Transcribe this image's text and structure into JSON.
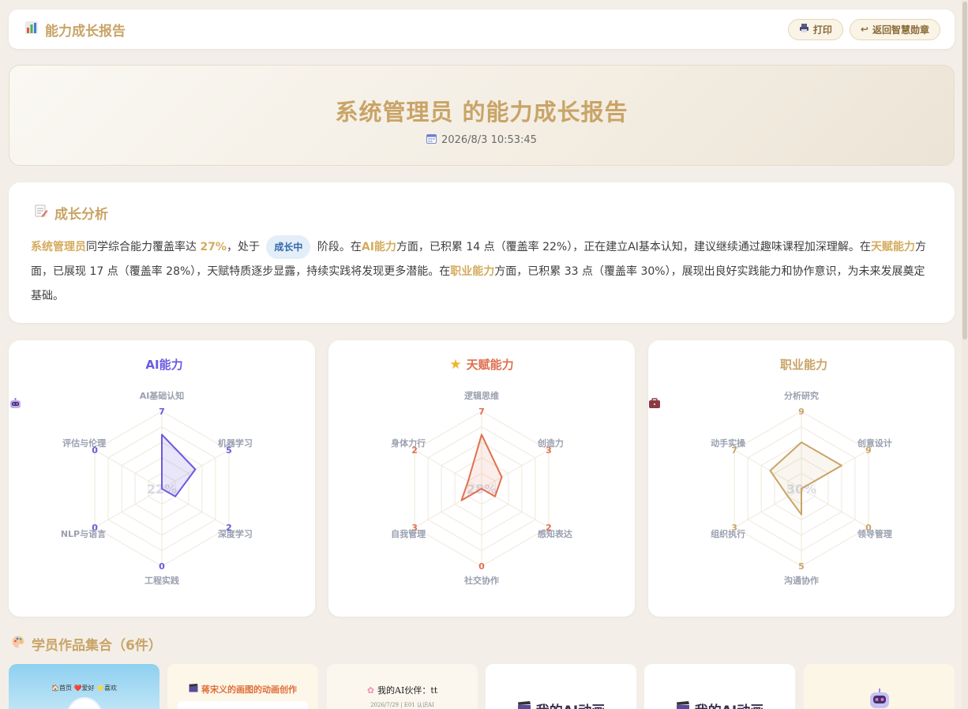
{
  "topbar": {
    "title": "能力成长报告",
    "print_label": "打印",
    "back_label": "返回智慧勋章"
  },
  "hero": {
    "title": "系统管理员 的能力成长报告",
    "date": "2026/8/3 10:53:45"
  },
  "analysis": {
    "heading": "成长分析",
    "name": "系统管理员",
    "t1": "同学综合能力覆盖率达 ",
    "rate": "27%",
    "t2": "，处于 ",
    "stage": "成长中",
    "t3": " 阶段。在",
    "ai": "AI能力",
    "t4": "方面，已积累 14 点（覆盖率 22%），正在建立AI基本认知，建议继续通过趣味课程加深理解。在",
    "talent": "天赋能力",
    "t5": "方面，已展现 17 点（覆盖率 28%），天赋特质逐步显露，持续实践将发现更多潜能。在",
    "career": "职业能力",
    "t6": "方面，已积累 33 点（覆盖率 30%），展现出良好实践能力和协作意识，为未来发展奠定基础。"
  },
  "colors": {
    "gold": "#c9a467",
    "ai": "#6a5ae0",
    "talent": "#e07050",
    "career": "#c9a467"
  },
  "chart_data": [
    {
      "type": "radar",
      "title": "AI能力",
      "center_label": "22%",
      "axes": [
        "AI基础认知",
        "机器学习",
        "深度学习",
        "工程实践",
        "NLP与语言",
        "评估与伦理"
      ],
      "values": [
        7,
        5,
        2,
        0,
        0,
        0
      ],
      "max": 10
    },
    {
      "type": "radar",
      "title": "天赋能力",
      "center_label": "28%",
      "axes": [
        "逻辑思维",
        "创造力",
        "感知表达",
        "社交协作",
        "自我管理",
        "身体力行"
      ],
      "values": [
        7,
        3,
        2,
        0,
        3,
        2
      ],
      "max": 10
    },
    {
      "type": "radar",
      "title": "职业能力",
      "center_label": "30%",
      "axes": [
        "分析研究",
        "创意设计",
        "领导管理",
        "沟通协作",
        "组织执行",
        "动手实操"
      ],
      "values": [
        9,
        9,
        0,
        5,
        3,
        7
      ],
      "max": 15
    }
  ],
  "works": {
    "title": "学员作品集合（6件）",
    "items": [
      {
        "caption": "🏠首页  ❤️爱好  ⭐喜欢"
      },
      {
        "caption": "蒋宋义的画图的动画创作"
      },
      {
        "caption": "我的AI伙伴：tt",
        "sub": "2026/7/29 | E01 认识AI"
      },
      {
        "caption": "我的AI动画"
      },
      {
        "caption": "我的AI动画"
      },
      {
        "caption": ""
      }
    ]
  }
}
